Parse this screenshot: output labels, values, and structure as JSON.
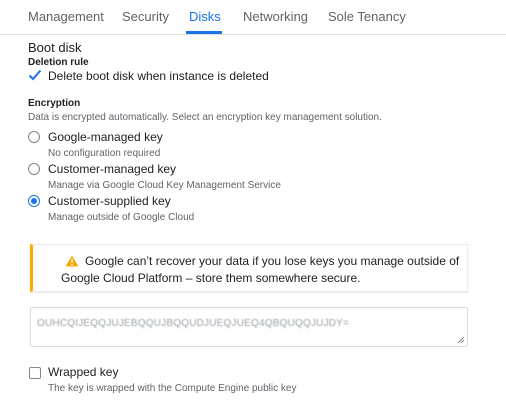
{
  "tabs": [
    {
      "label": "Management",
      "active": false
    },
    {
      "label": "Security",
      "active": false
    },
    {
      "label": "Disks",
      "active": true
    },
    {
      "label": "Networking",
      "active": false
    },
    {
      "label": "Sole Tenancy",
      "active": false
    }
  ],
  "boot_disk": {
    "title": "Boot disk",
    "deletion_rule": {
      "heading": "Deletion rule",
      "checkbox_label": "Delete boot disk when instance is deleted",
      "checked": true
    }
  },
  "encryption": {
    "heading": "Encryption",
    "description": "Data is encrypted automatically. Select an encryption key management solution.",
    "options": [
      {
        "label": "Google-managed key",
        "description": "No configuration required",
        "selected": false
      },
      {
        "label": "Customer-managed key",
        "description": "Manage via Google Cloud Key Management Service",
        "selected": false
      },
      {
        "label": "Customer-supplied key",
        "description": "Manage outside of Google Cloud",
        "selected": true
      }
    ]
  },
  "warning": {
    "icon": "warning-icon",
    "line1": "Google can’t recover your data if you lose keys you manage outside of",
    "line2": "Google Cloud Platform – store them somewhere secure.",
    "accent_color": "#f9ab00"
  },
  "key_input": {
    "value": "OUHCQIJEQQJUJEBQQUJBQQUDJUEQJUEQ4QBQUQQJUJDY="
  },
  "wrapped_key": {
    "label": "Wrapped key",
    "description": "The key is wrapped with the Compute Engine public key",
    "checked": false
  },
  "colors": {
    "accent": "#1a73e8",
    "text": "#202124",
    "secondary_text": "#5f6368"
  }
}
